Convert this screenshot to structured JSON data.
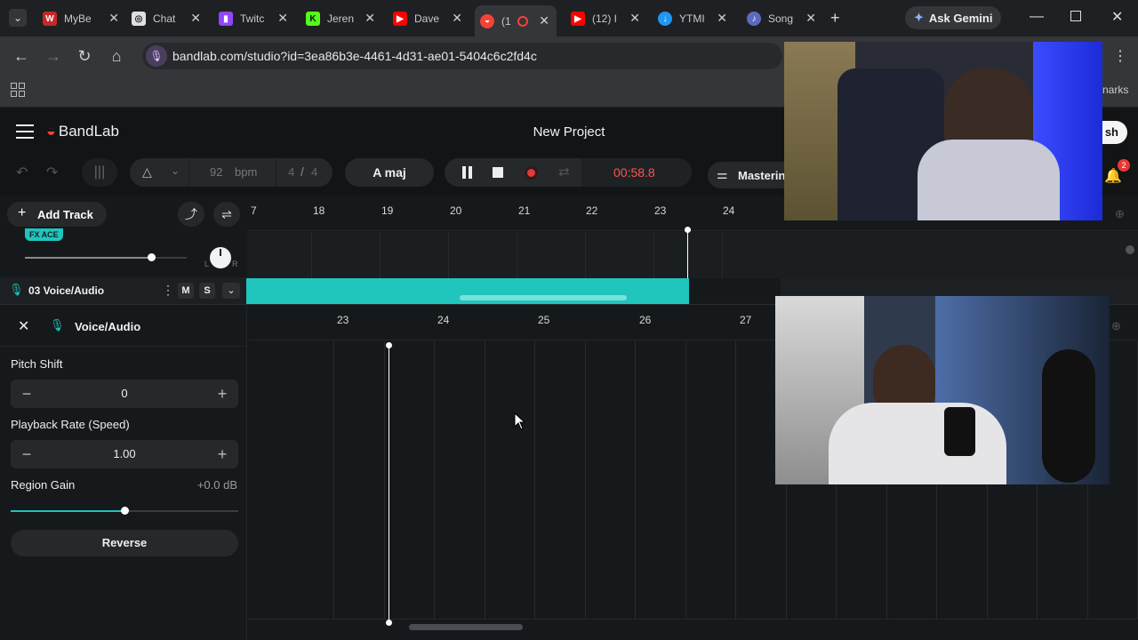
{
  "browser": {
    "tabs": [
      {
        "label": "MyBe",
        "icon": "w-icon",
        "color": "#c62828"
      },
      {
        "label": "Chat",
        "icon": "chatgpt-icon",
        "color": "#e0e0e0"
      },
      {
        "label": "Twitc",
        "icon": "twitch-icon",
        "color": "#9146ff"
      },
      {
        "label": "Jeren",
        "icon": "kick-icon",
        "color": "#53fc18"
      },
      {
        "label": "Dave",
        "icon": "youtube-icon",
        "color": "#ff0000"
      },
      {
        "label": "(1",
        "icon": "bandlab-icon",
        "color": "#f44336"
      },
      {
        "label": "(12) I",
        "icon": "youtube-icon",
        "color": "#ff0000"
      },
      {
        "label": "YTMI",
        "icon": "ytmp3-icon",
        "color": "#2196f3"
      },
      {
        "label": "Song",
        "icon": "song-icon",
        "color": "#5c6bc0"
      }
    ],
    "ask_gemini": "Ask Gemini",
    "url": "bandlab.com/studio?id=3ea86b3e-4461-4d31-ae01-5404c6c2fd4c",
    "bookmarks_partial": "narks"
  },
  "app": {
    "brand": "BandLab",
    "project_title": "New Project",
    "publish_partial": "sh",
    "notifications_count": "2",
    "mastering_label": "Mastering"
  },
  "transport": {
    "bpm_value": "92",
    "bpm_label": "bpm",
    "time_sig_num": "4",
    "time_sig_sep": "/",
    "time_sig_den": "4",
    "key": "A maj",
    "time": "00:58.8"
  },
  "tracks": {
    "add_track": "Add Track",
    "fx_badge": "FX ACE",
    "pan_left": "L",
    "pan_right": "R",
    "track_name": "03  Voice/Audio",
    "mute": "M",
    "solo": "S"
  },
  "ruler_top": {
    "partial_first": "7",
    "numbers": [
      "18",
      "19",
      "20",
      "21",
      "22",
      "23",
      "24"
    ]
  },
  "ruler_editor": {
    "numbers": [
      "23",
      "24",
      "25",
      "26",
      "27"
    ]
  },
  "editor": {
    "title": "Voice/Audio",
    "pitch_label": "Pitch Shift",
    "pitch_value": "0",
    "rate_label": "Playback Rate (Speed)",
    "rate_value": "1.00",
    "gain_label": "Region Gain",
    "gain_value": "+0.0 dB",
    "reverse_label": "Reverse",
    "gain_slider_level": 0.5
  },
  "colors": {
    "accent": "#20c5bd",
    "record": "#e53935",
    "time": "#ff5252"
  }
}
